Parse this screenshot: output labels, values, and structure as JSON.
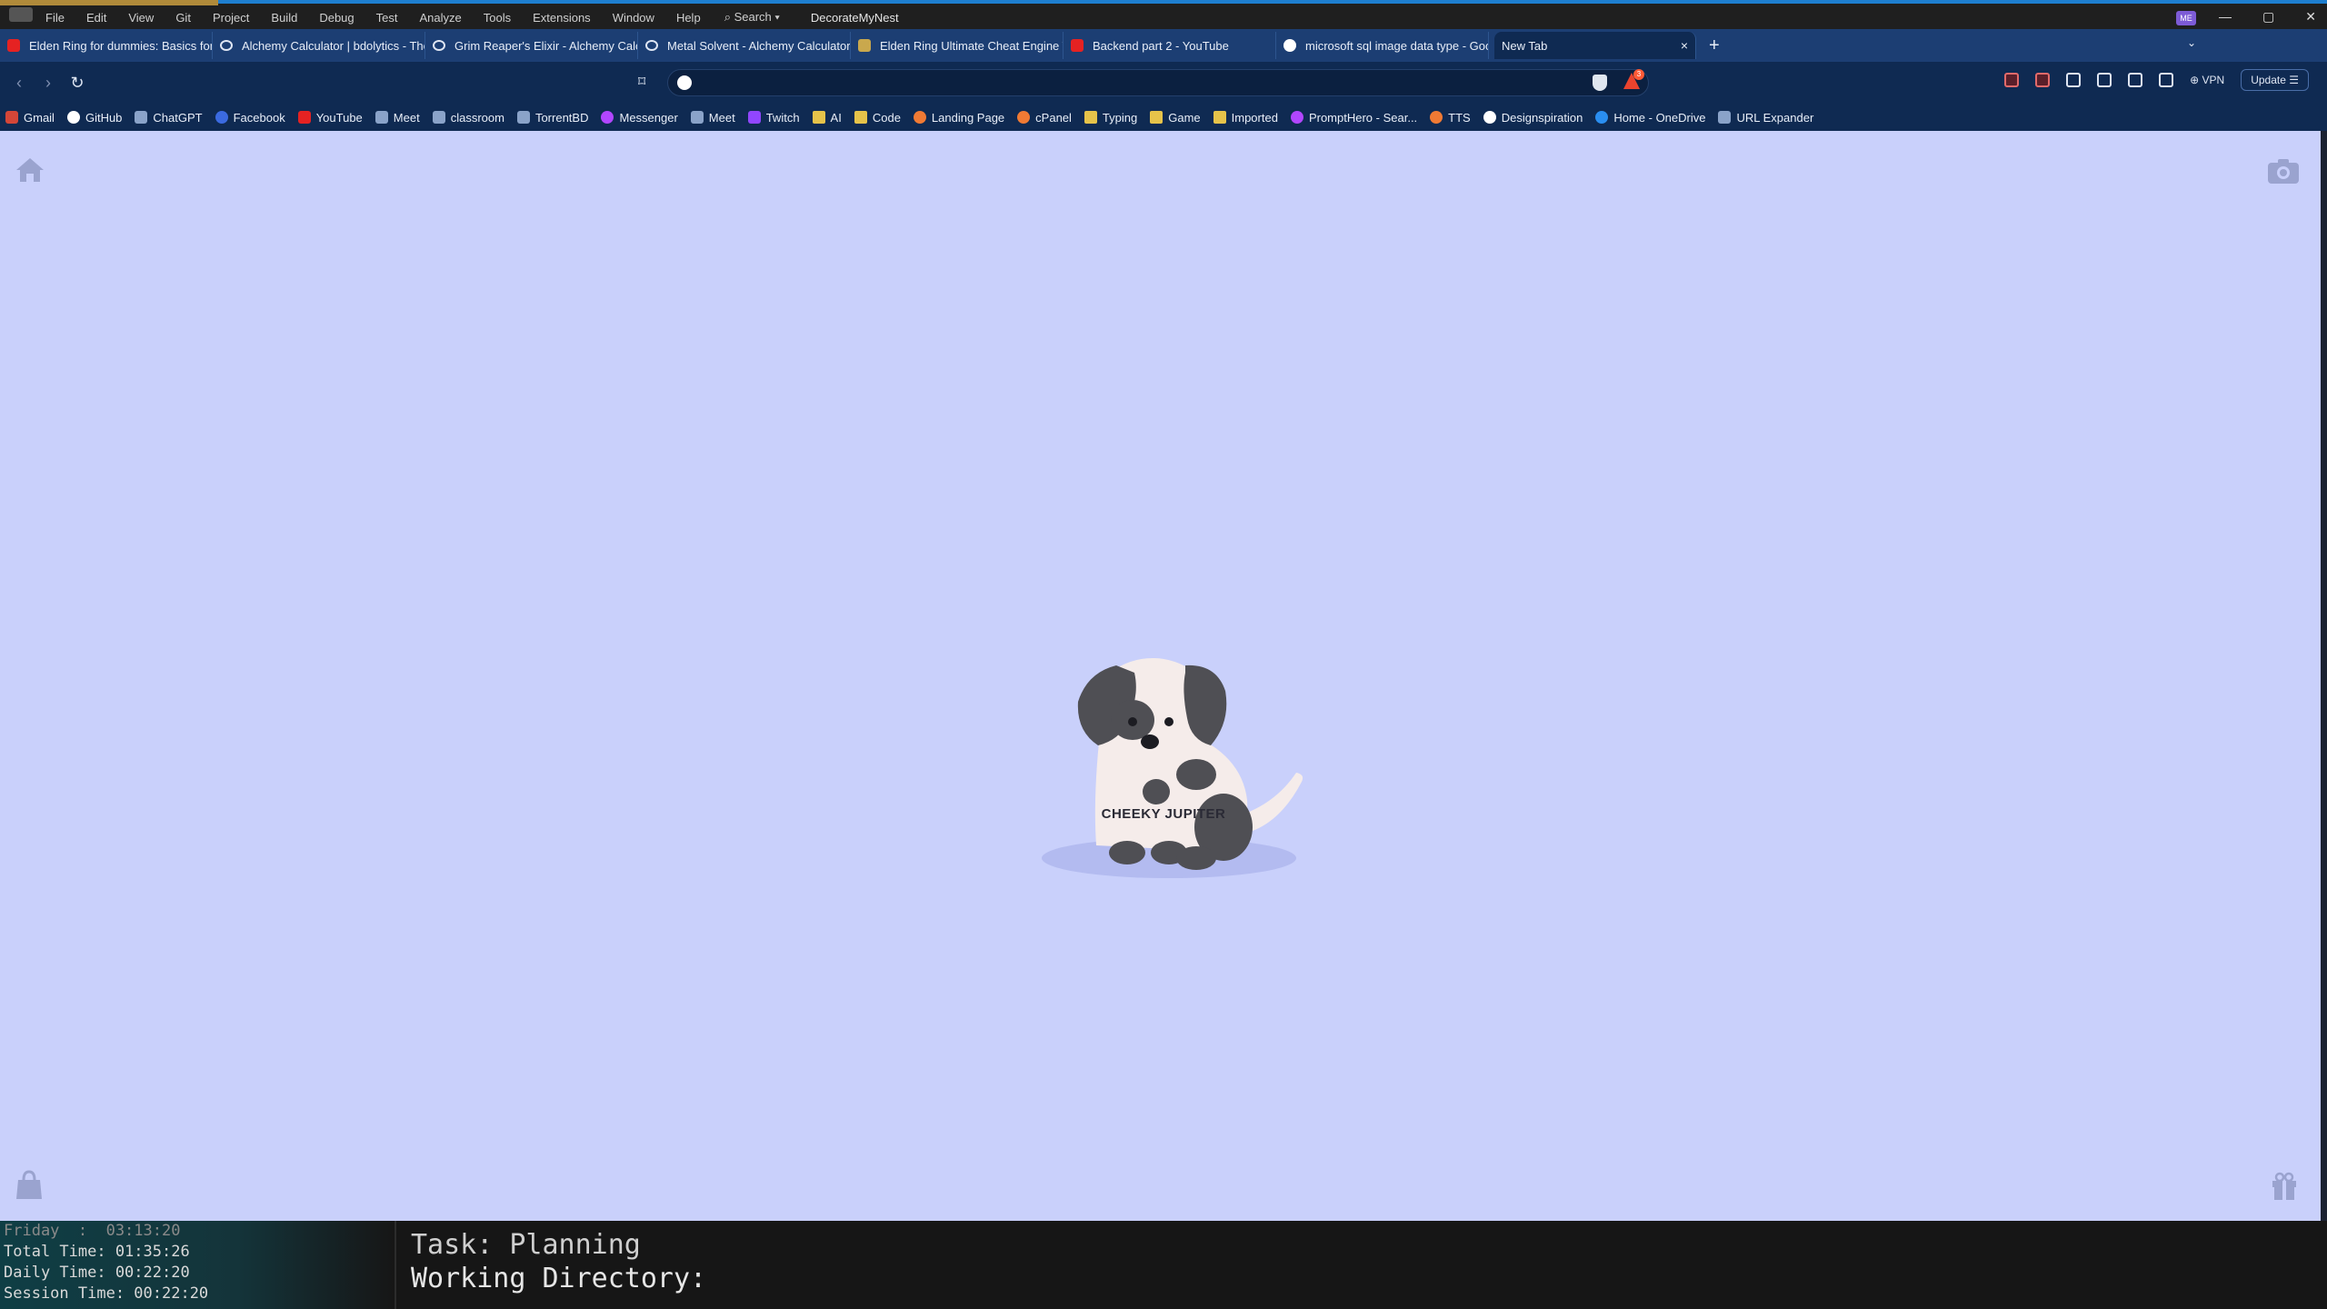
{
  "ide": {
    "menu": [
      "File",
      "Edit",
      "View",
      "Git",
      "Project",
      "Build",
      "Debug",
      "Test",
      "Analyze",
      "Tools",
      "Extensions",
      "Window",
      "Help"
    ],
    "search_label": "⌕ Search ▾",
    "project": "DecorateMyNest",
    "avatar": "ME"
  },
  "tabs": [
    {
      "title": "Elden Ring for dummies: Basics for E",
      "icon": "youtube-icon"
    },
    {
      "title": "Alchemy Calculator | bdolytics - The",
      "icon": "bdolytics-icon"
    },
    {
      "title": "Grim Reaper's Elixir - Alchemy Calcu",
      "icon": "bdolytics-icon"
    },
    {
      "title": "Metal Solvent - Alchemy Calculator |",
      "icon": "bdolytics-icon"
    },
    {
      "title": "Elden Ring Ultimate Cheat Engine Ta",
      "icon": "elden-ring-icon"
    },
    {
      "title": "Backend part 2 - YouTube",
      "icon": "youtube-icon"
    },
    {
      "title": "microsoft sql image data type - Goo",
      "icon": "google-icon"
    }
  ],
  "active_tab": {
    "title": "New Tab",
    "close": "×"
  },
  "new_tab_button": "+",
  "toolbar": {
    "back": "‹",
    "forward": "›",
    "reload": "↻",
    "address_value": "",
    "vpn_label": "⊕ VPN",
    "update_label": "Update ☰",
    "rewards_badge": "3"
  },
  "bookmarks": [
    {
      "label": "Gmail",
      "icon": "gm"
    },
    {
      "label": "GitHub",
      "icon": "gh"
    },
    {
      "label": "ChatGPT",
      "icon": "gpt"
    },
    {
      "label": "Facebook",
      "icon": "fb"
    },
    {
      "label": "YouTube",
      "icon": "yt"
    },
    {
      "label": "Meet",
      "icon": "meet"
    },
    {
      "label": "classroom",
      "icon": "cls"
    },
    {
      "label": "TorrentBD",
      "icon": "tbd"
    },
    {
      "label": "Messenger",
      "icon": "ms"
    },
    {
      "label": "Meet",
      "icon": "meet"
    },
    {
      "label": "Twitch",
      "icon": "tw"
    },
    {
      "label": "AI",
      "icon": "folder"
    },
    {
      "label": "Code",
      "icon": "folder"
    },
    {
      "label": "Landing Page",
      "icon": "or"
    },
    {
      "label": "cPanel",
      "icon": "or"
    },
    {
      "label": "Typing",
      "icon": "folder"
    },
    {
      "label": "Game",
      "icon": "folder"
    },
    {
      "label": "Imported",
      "icon": "folder"
    },
    {
      "label": "PromptHero - Sear...",
      "icon": "ph"
    },
    {
      "label": "TTS",
      "icon": "or"
    },
    {
      "label": "Designspiration",
      "icon": "ds"
    },
    {
      "label": "Home - OneDrive",
      "icon": "od"
    },
    {
      "label": "URL Expander",
      "icon": "url"
    }
  ],
  "newtab": {
    "pet_name": "CHEEKY JUPITER",
    "background": "#c9d0fb"
  },
  "terminal": {
    "day_line": "Friday  :  03:13:20",
    "total_time": "Total Time: 01:35:26",
    "daily_time": "Daily Time: 00:22:20",
    "session_time": "Session Time: 00:22:20",
    "task": "Task: Planning",
    "working_dir": "Working Directory:"
  },
  "colors": {
    "tabstrip": "#1c3e73",
    "toolbar": "#0f2a52",
    "page": "#c9d0fb",
    "accent": "#1e7fd0"
  }
}
